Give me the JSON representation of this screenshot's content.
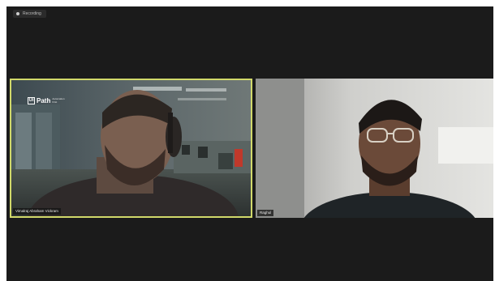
{
  "recording": {
    "label": "Recording"
  },
  "participants": [
    {
      "name": "Vimalraj Abraham Vickram",
      "active_speaker": true,
      "background_logo": {
        "mark": "Ui",
        "name": "Path",
        "tagline": "Automation First"
      }
    },
    {
      "name": "Raghul",
      "active_speaker": false
    }
  ],
  "colors": {
    "app_background": "#1b1b1b",
    "active_speaker_border": "#d1d96a",
    "page_background": "#ffffff"
  }
}
